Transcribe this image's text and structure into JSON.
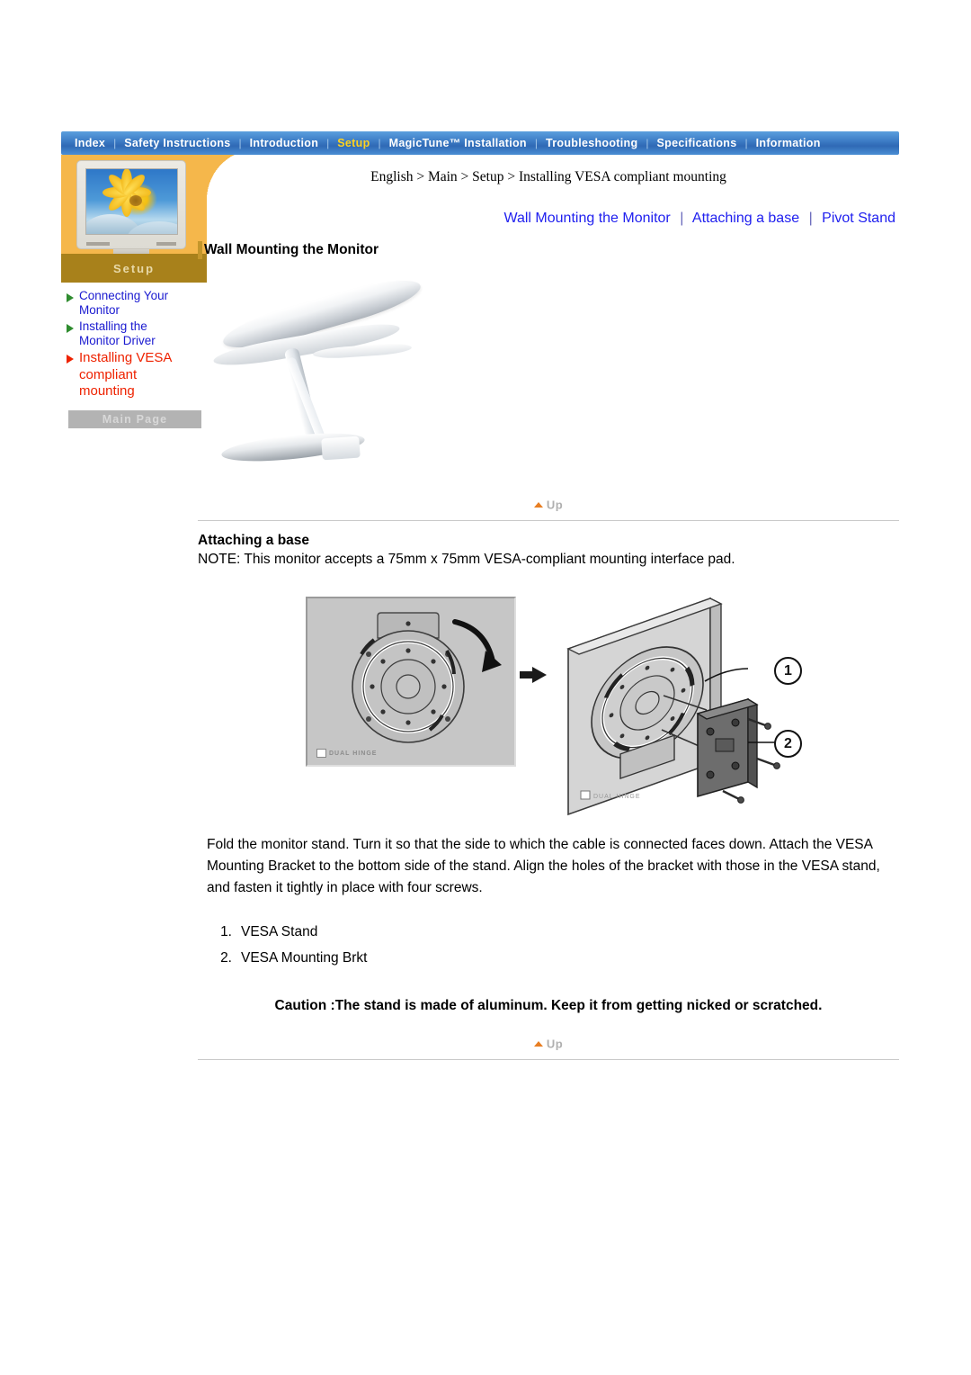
{
  "topnav": {
    "items": [
      {
        "label": "Index",
        "active": false
      },
      {
        "label": "Safety Instructions",
        "active": false
      },
      {
        "label": "Introduction",
        "active": false
      },
      {
        "label": "Setup",
        "active": true
      },
      {
        "label": "MagicTune™ Installation",
        "active": false
      },
      {
        "label": "Troubleshooting",
        "active": false
      },
      {
        "label": "Specifications",
        "active": false
      },
      {
        "label": "Information",
        "active": false
      }
    ],
    "separator": "|"
  },
  "sidebar": {
    "banner_label": "Setup",
    "links": [
      {
        "label": "Connecting Your Monitor",
        "current": false
      },
      {
        "label": "Installing the Monitor Driver",
        "current": false
      },
      {
        "label": "Installing VESA compliant mounting",
        "current": true
      }
    ],
    "main_page_button": "Main Page"
  },
  "content": {
    "breadcrumb": "English > Main > Setup > Installing VESA compliant mounting",
    "subnav": [
      "Wall Mounting the Monitor",
      "Attaching a base",
      "Pivot Stand"
    ],
    "subnav_separator": "|",
    "section1_title": "Wall Mounting the Monitor",
    "section2_title": "Attaching a base",
    "note": "NOTE: This monitor accepts a 75mm x 75mm VESA-compliant mounting interface pad.",
    "instructions": "Fold the monitor stand. Turn it so that the side to which the cable is connected faces down. Attach the VESA Mounting Bracket to the bottom side of the stand. Align the holes of the bracket with those in the VESA stand, and fasten it tightly in place with four screws.",
    "parts": [
      {
        "num": "1.",
        "label": "VESA Stand"
      },
      {
        "num": "2.",
        "label": "VESA Mounting Brkt"
      }
    ],
    "caution": "Caution :The stand is made of aluminum. Keep it from getting nicked or scratched.",
    "up_label": "Up",
    "figure_label_dualhinge": "DUAL HINGE",
    "callout_1": "1",
    "callout_2": "2"
  },
  "colors": {
    "nav_blue": "#3f7fc8",
    "nav_active_text": "#ffd21e",
    "sidebar_orange": "#f5b74b",
    "setup_strip": "#a8811b",
    "link_blue": "#2020ef",
    "current_red": "#ee2200",
    "bullet_green": "#2f8c2f",
    "up_orange": "#e87e22",
    "accent_gold_bar": "#c4962b"
  }
}
